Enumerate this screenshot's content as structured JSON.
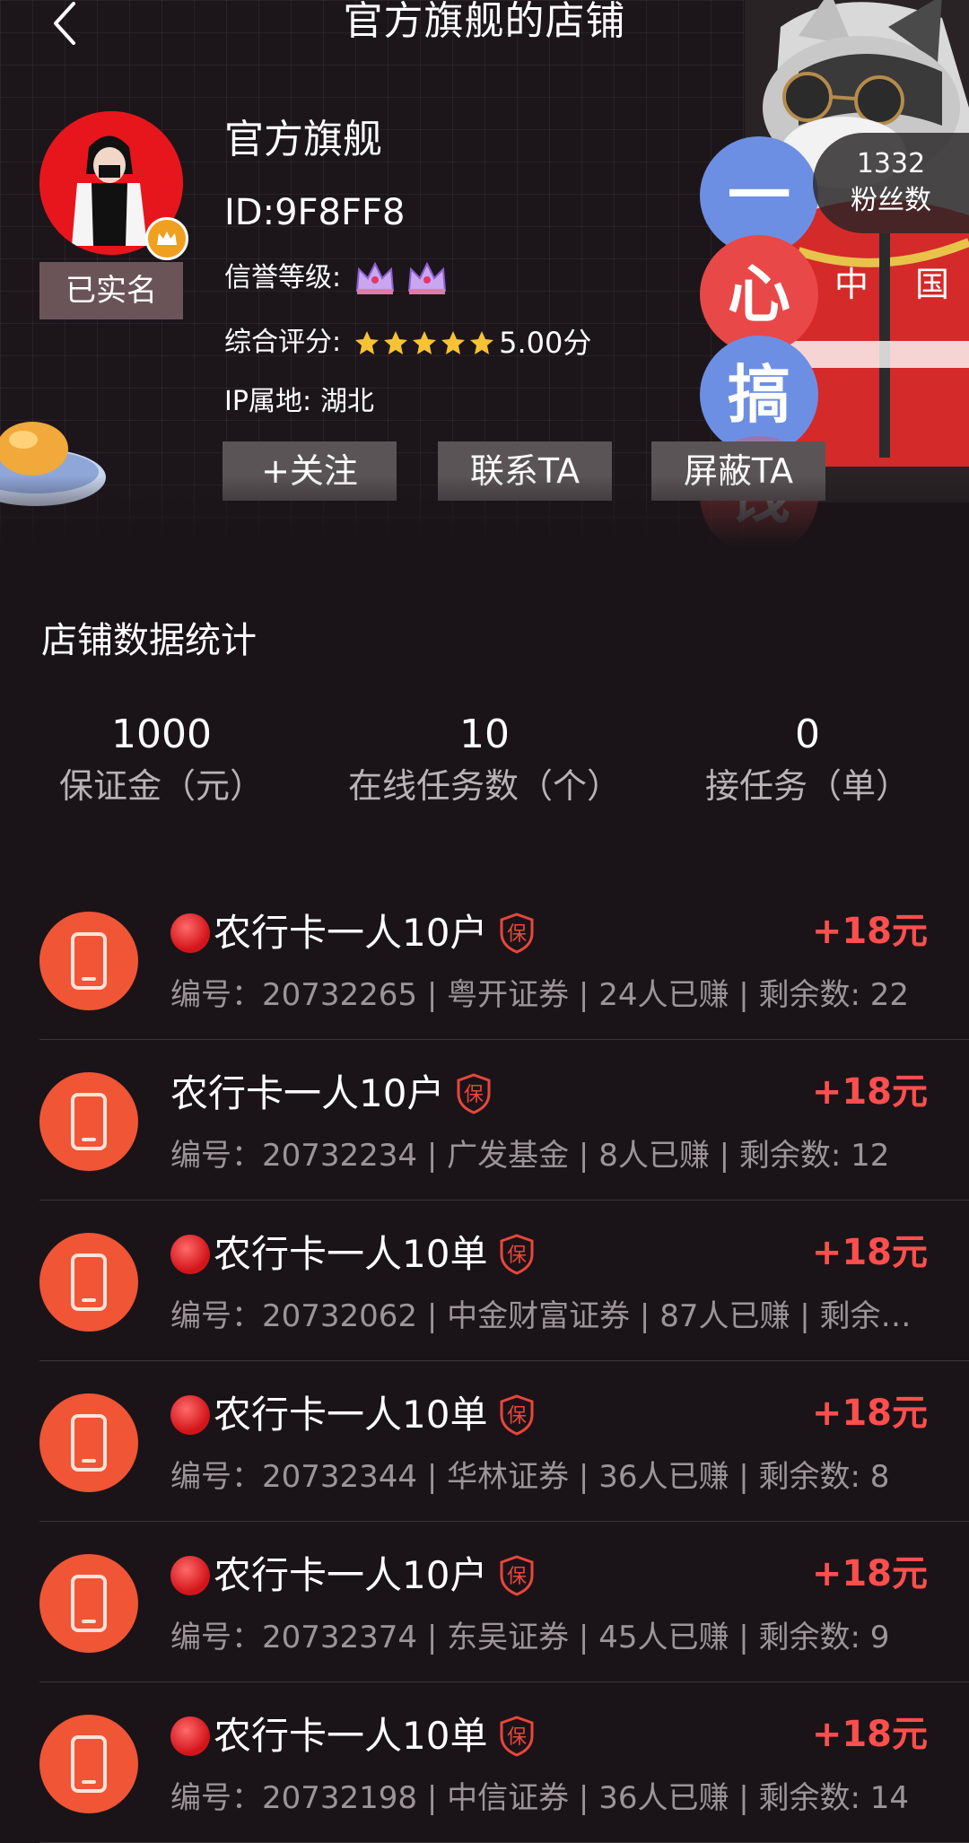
{
  "header": {
    "title": "官方旗舰的店铺",
    "back_icon": "chevron-left-icon"
  },
  "profile": {
    "verified_label": "已实名",
    "name": "官方旗舰",
    "id_text": "ID:9F8FF8",
    "credit_label": "信誉等级:",
    "credit_level": 2,
    "score_label": "综合评分:",
    "score_stars": 5,
    "score_value": "5.00分",
    "ip_label": "IP属地:",
    "ip_value": "湖北",
    "fans_count": "1332",
    "fans_label": "粉丝数"
  },
  "actions": {
    "follow": "+关注",
    "contact": "联系TA",
    "block": "屏蔽TA"
  },
  "stickers": [
    "一",
    "心",
    "搞",
    "钱"
  ],
  "stats": {
    "title": "店铺数据统计",
    "items": [
      {
        "value": "1000",
        "label": "保证金（元）"
      },
      {
        "value": "10",
        "label": "在线任务数（个）"
      },
      {
        "value": "0",
        "label": "接任务（单）"
      }
    ]
  },
  "tasks": [
    {
      "dot": true,
      "title": "农行卡一人10户",
      "reward": "+18元",
      "desc": "编号：20732265 | 粤开证券 | 24人已赚 | 剩余数: 22"
    },
    {
      "dot": false,
      "title": "农行卡一人10户",
      "reward": "+18元",
      "desc": "编号：20732234 | 广发基金 | 8人已赚 | 剩余数: 12"
    },
    {
      "dot": true,
      "title": "农行卡一人10单",
      "reward": "+18元",
      "desc": "编号：20732062 | 中金财富证券 | 87人已赚 | 剩余…"
    },
    {
      "dot": true,
      "title": "农行卡一人10单",
      "reward": "+18元",
      "desc": "编号：20732344 | 华林证券 | 36人已赚 | 剩余数: 8"
    },
    {
      "dot": true,
      "title": "农行卡一人10户",
      "reward": "+18元",
      "desc": "编号：20732374 | 东吴证券 | 45人已赚 | 剩余数: 9"
    },
    {
      "dot": true,
      "title": "农行卡一人10单",
      "reward": "+18元",
      "desc": "编号：20732198 | 中信证券 | 36人已赚 | 剩余数: 14"
    }
  ],
  "colors": {
    "background": "#1a1418",
    "reward": "#ff4e4e",
    "task_icon": "#f05535",
    "button": "#5a5457"
  }
}
